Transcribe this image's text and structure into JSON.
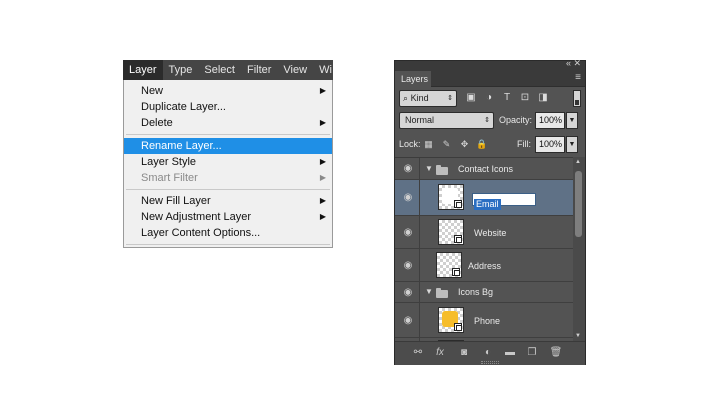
{
  "menubar": {
    "items": [
      "Layer",
      "Type",
      "Select",
      "Filter",
      "View",
      "Wi"
    ]
  },
  "layer_menu": {
    "new": "New",
    "duplicate": "Duplicate Layer...",
    "delete": "Delete",
    "rename": "Rename Layer...",
    "layer_style": "Layer Style",
    "smart_filter": "Smart Filter",
    "new_fill": "New Fill Layer",
    "new_adjustment": "New Adjustment Layer",
    "content_options": "Layer Content Options..."
  },
  "panel": {
    "tab": "Layers",
    "filter_kind": "Kind",
    "blend_mode": "Normal",
    "opacity_label": "Opacity:",
    "opacity_value": "100%",
    "lock_label": "Lock:",
    "fill_label": "Fill:",
    "fill_value": "100%",
    "layers": {
      "group1": "Contact Icons",
      "email_edit": "Email",
      "website": "Website",
      "address": "Address",
      "group2": "Icons Bg",
      "phone": "Phone"
    }
  },
  "colors": {
    "highlight": "#1f8fe6",
    "panel_bg": "#535353",
    "selected_row": "#5f7186",
    "icon_fill": "#f6bd2b"
  }
}
